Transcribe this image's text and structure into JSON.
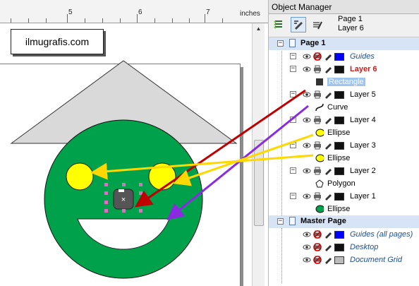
{
  "canvas": {
    "ruler": {
      "numbers": [
        "5",
        "6",
        "7"
      ],
      "unit": "inches"
    },
    "website_label": "ilmugrafis.com",
    "colors": {
      "roof": "#d9d9d9",
      "face": "#00a14b",
      "eyes": "#ffff00",
      "mouth": "#ffffff",
      "nose": "#555555",
      "selection_handles": "#e06cc4",
      "arrow_red": "#c00000",
      "arrow_purple": "#8a2be2",
      "arrow_yellow": "#ffd800"
    }
  },
  "object_manager": {
    "title": "Object Manager",
    "page_info": {
      "page": "Page 1",
      "layer": "Layer 6"
    },
    "page1": {
      "label": "Page 1",
      "rows": [
        {
          "type": "layer",
          "name": "Guides",
          "italic": true,
          "color": "#0000ff"
        },
        {
          "type": "layer",
          "name": "Layer 6",
          "active": true,
          "color": "#111111"
        },
        {
          "type": "object",
          "name": "Rectangle",
          "icon": "rectangle-icon",
          "selected": true
        },
        {
          "type": "layer",
          "name": "Layer 5",
          "color": "#111111"
        },
        {
          "type": "object",
          "name": "Curve",
          "icon": "curve-icon"
        },
        {
          "type": "layer",
          "name": "Layer 4",
          "color": "#111111"
        },
        {
          "type": "object",
          "name": "Ellipse",
          "icon": "ellipse-yellow-icon"
        },
        {
          "type": "layer",
          "name": "Layer 3",
          "color": "#111111"
        },
        {
          "type": "object",
          "name": "Ellipse",
          "icon": "ellipse-yellow-icon"
        },
        {
          "type": "layer",
          "name": "Layer 2",
          "color": "#111111"
        },
        {
          "type": "object",
          "name": "Polygon",
          "icon": "polygon-icon"
        },
        {
          "type": "layer",
          "name": "Layer 1",
          "color": "#111111"
        },
        {
          "type": "object",
          "name": "Ellipse",
          "icon": "ellipse-green-icon"
        }
      ]
    },
    "master": {
      "label": "Master Page",
      "rows": [
        {
          "type": "layer",
          "name": "Guides (all pages)",
          "italic": true,
          "color": "#0000ff"
        },
        {
          "type": "layer",
          "name": "Desktop",
          "italic": true,
          "color": "#111111"
        },
        {
          "type": "layer",
          "name": "Document Grid",
          "italic": true,
          "color": "#bbbbbb"
        }
      ]
    }
  }
}
